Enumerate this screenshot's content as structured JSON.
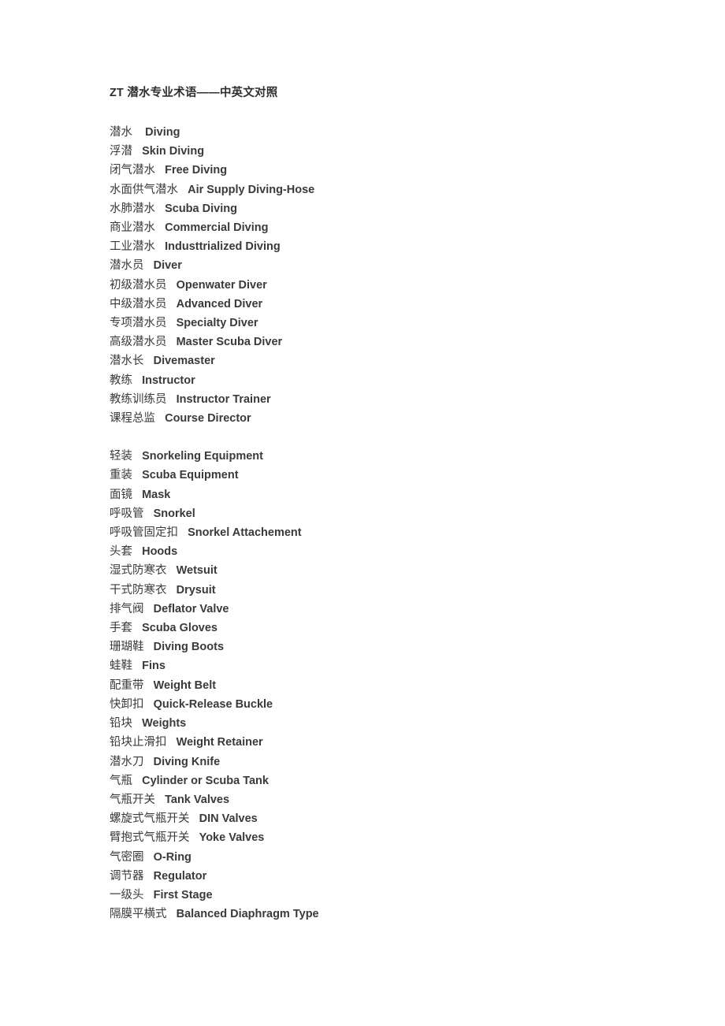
{
  "document": {
    "title_prefix": "ZT",
    "title_rest": " 潜水专业术语——中英文对照",
    "title_full": "ZT 潜水专业术语——中英文对照"
  },
  "blocks": [
    {
      "name": "diving-types-and-certifications",
      "lines": [
        {
          "cn": "潜水",
          "gap": "    ",
          "en": "Diving"
        },
        {
          "cn": "浮潜",
          "gap": "   ",
          "en": "Skin Diving"
        },
        {
          "cn": "闭气潜水",
          "gap": "   ",
          "en": "Free Diving"
        },
        {
          "cn": "水面供气潜水",
          "gap": "   ",
          "en": "Air Supply Diving-Hose"
        },
        {
          "cn": "水肺潜水",
          "gap": "   ",
          "en": "Scuba Diving"
        },
        {
          "cn": "商业潜水",
          "gap": "   ",
          "en": "Commercial Diving"
        },
        {
          "cn": "工业潜水",
          "gap": "   ",
          "en": "Industtrialized Diving"
        },
        {
          "cn": "潜水员",
          "gap": "   ",
          "en": "Diver"
        },
        {
          "cn": "初级潜水员",
          "gap": "   ",
          "en": "Openwater Diver"
        },
        {
          "cn": "中级潜水员",
          "gap": "   ",
          "en": "Advanced Diver"
        },
        {
          "cn": "专项潜水员",
          "gap": "   ",
          "en": "Specialty Diver"
        },
        {
          "cn": "高级潜水员",
          "gap": "   ",
          "en": "Master Scuba Diver"
        },
        {
          "cn": "潜水长",
          "gap": "   ",
          "en": "Divemaster"
        },
        {
          "cn": "教练",
          "gap": "   ",
          "en": "Instructor"
        },
        {
          "cn": "教练训练员",
          "gap": "   ",
          "en": "Instructor Trainer"
        },
        {
          "cn": "课程总监",
          "gap": "   ",
          "en": "Course Director"
        }
      ]
    },
    {
      "name": "diving-equipment",
      "lines": [
        {
          "cn": "轻装",
          "gap": "   ",
          "en": "Snorkeling Equipment"
        },
        {
          "cn": "重装",
          "gap": "   ",
          "en": "Scuba Equipment"
        },
        {
          "cn": "面镜",
          "gap": "   ",
          "en": "Mask"
        },
        {
          "cn": "呼吸管",
          "gap": "   ",
          "en": "Snorkel"
        },
        {
          "cn": "呼吸管固定扣",
          "gap": "   ",
          "en": "Snorkel Attachement"
        },
        {
          "cn": "头套",
          "gap": "   ",
          "en": "Hoods"
        },
        {
          "cn": "湿式防寒衣",
          "gap": "   ",
          "en": "Wetsuit"
        },
        {
          "cn": "干式防寒衣",
          "gap": "   ",
          "en": "Drysuit"
        },
        {
          "cn": "排气阀",
          "gap": "   ",
          "en": "Deflator Valve"
        },
        {
          "cn": "手套",
          "gap": "   ",
          "en": "Scuba Gloves"
        },
        {
          "cn": "珊瑚鞋",
          "gap": "   ",
          "en": "Diving Boots"
        },
        {
          "cn": "蛙鞋",
          "gap": "   ",
          "en": "Fins"
        },
        {
          "cn": "配重带",
          "gap": "   ",
          "en": "Weight Belt"
        },
        {
          "cn": "快卸扣",
          "gap": "   ",
          "en": "Quick-Release Buckle"
        },
        {
          "cn": "铅块",
          "gap": "   ",
          "en": "Weights"
        },
        {
          "cn": "铅块止滑扣",
          "gap": "   ",
          "en": "Weight Retainer"
        },
        {
          "cn": "潜水刀",
          "gap": "   ",
          "en": "Diving Knife"
        },
        {
          "cn": "气瓶",
          "gap": "   ",
          "en": "Cylinder or Scuba Tank"
        },
        {
          "cn": "气瓶开关",
          "gap": "   ",
          "en": "Tank Valves"
        },
        {
          "cn": "螺旋式气瓶开关",
          "gap": "   ",
          "en": "DIN Valves"
        },
        {
          "cn": "臂抱式气瓶开关",
          "gap": "   ",
          "en": "Yoke Valves"
        },
        {
          "cn": "气密圈",
          "gap": "   ",
          "en": "O-Ring"
        },
        {
          "cn": "调节器",
          "gap": "   ",
          "en": "Regulator"
        },
        {
          "cn": "一级头",
          "gap": "   ",
          "en": "First Stage"
        },
        {
          "cn": "隔膜平横式",
          "gap": "   ",
          "en": "Balanced Diaphragm Type"
        }
      ]
    }
  ],
  "colors": {
    "page_background": "#ffffff",
    "body_text": "#3a3a3a",
    "title_text": "#2e2e2e"
  }
}
